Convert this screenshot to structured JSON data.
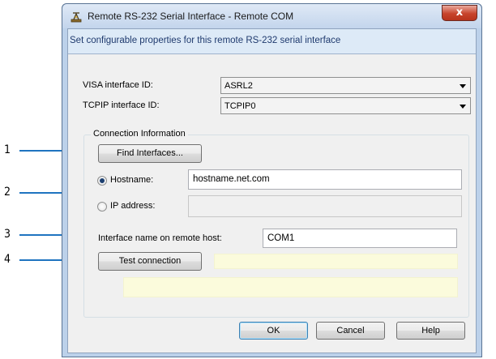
{
  "window": {
    "title": "Remote RS-232 Serial Interface - Remote COM",
    "close_label": "x",
    "banner": "Set configurable properties for this  remote RS-232 serial interface"
  },
  "visa": {
    "label": "VISA interface ID:",
    "value": "ASRL2"
  },
  "tcpip": {
    "label": "TCPIP interface ID:",
    "value": "TCPIP0"
  },
  "connection": {
    "group_label": "Connection Information",
    "find_button": "Find Interfaces...",
    "hostname_label": "Hostname:",
    "hostname_value": "hostname.net.com",
    "hostname_selected": true,
    "ip_label": "IP address:",
    "ip_value": "",
    "interface_name_label": "Interface name on remote host:",
    "interface_name_value": "COM1",
    "test_button": "Test connection",
    "test_status": "",
    "status_message": ""
  },
  "buttons": {
    "ok": "OK",
    "cancel": "Cancel",
    "help": "Help"
  },
  "callouts": [
    "1",
    "2",
    "3",
    "4"
  ],
  "colors": {
    "callout_line": "#1f74c0",
    "banner_bg": "#ddeaf7",
    "status_bg": "#fbfbdc"
  }
}
